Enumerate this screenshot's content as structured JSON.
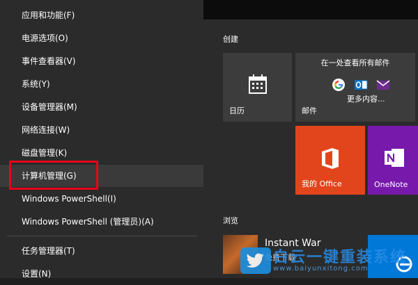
{
  "context_menu": {
    "items": [
      {
        "label": "应用和功能(F)"
      },
      {
        "label": "电源选项(O)"
      },
      {
        "label": "事件查看器(V)"
      },
      {
        "label": "系统(Y)"
      },
      {
        "label": "设备管理器(M)"
      },
      {
        "label": "网络连接(W)"
      },
      {
        "label": "磁盘管理(K)"
      },
      {
        "label": "计算机管理(G)",
        "state": "hover",
        "highlighted": true
      },
      {
        "label": "Windows PowerShell(I)"
      },
      {
        "label": "Windows PowerShell (管理员)(A)"
      },
      {
        "label": "任务管理器(T)"
      },
      {
        "label": "设置(N)"
      }
    ],
    "highlight_color": "#e8001c"
  },
  "start_pane": {
    "group_create": "创建",
    "group_browse": "浏览",
    "tiles": {
      "calendar": {
        "label": "日历",
        "icon": "calendar-icon"
      },
      "mail": {
        "label": "邮件",
        "title": "在一处查看所有邮件",
        "more": "更多内容...",
        "icons": [
          "google-icon",
          "outlook-icon",
          "mail-envelope-icon"
        ]
      },
      "office": {
        "label": "我的 Office",
        "icon": "office-icon",
        "color": "#e2451c"
      },
      "onenote": {
        "label": "OneNote",
        "icon": "onenote-icon",
        "color": "#7719aa"
      }
    },
    "game": {
      "title": "Instant War",
      "subtitle": "免费下载"
    }
  },
  "watermark": {
    "text": "白云一键重装系统",
    "url": "www.baiyunxitong.com",
    "icon": "twitter-bird-icon"
  }
}
